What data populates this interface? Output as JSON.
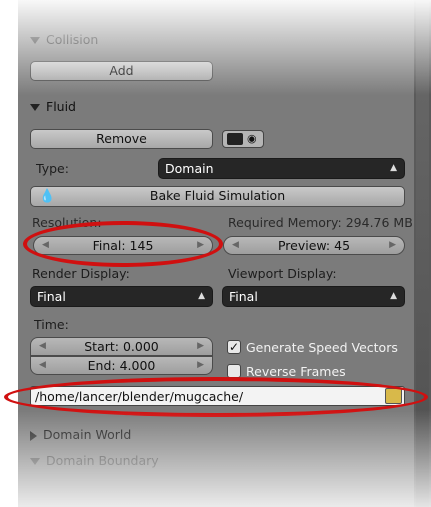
{
  "collision": {
    "title": "Collision",
    "add_label": "Add"
  },
  "fluid": {
    "title": "Fluid",
    "remove_label": "Remove",
    "type_label": "Type:",
    "type_value": "Domain",
    "bake_label": "Bake Fluid Simulation",
    "resolution_label": "Resolution:",
    "memory_label": "Required Memory: 294.76 MB",
    "final_field": "Final: 145",
    "preview_field": "Preview: 45",
    "render_display_label": "Render Display:",
    "viewport_display_label": "Viewport Display:",
    "render_display_value": "Final",
    "viewport_display_value": "Final",
    "time_label": "Time:",
    "start_field": "Start: 0.000",
    "end_field": "End: 4.000",
    "speed_vectors_label": "Generate Speed Vectors",
    "speed_vectors_checked": true,
    "reverse_frames_label": "Reverse Frames",
    "cache_path": "/home/lancer/blender/mugcache/"
  },
  "domain_world": {
    "title": "Domain World"
  },
  "domain_boundary": {
    "title": "Domain Boundary"
  },
  "highlight_color": "#d01010"
}
